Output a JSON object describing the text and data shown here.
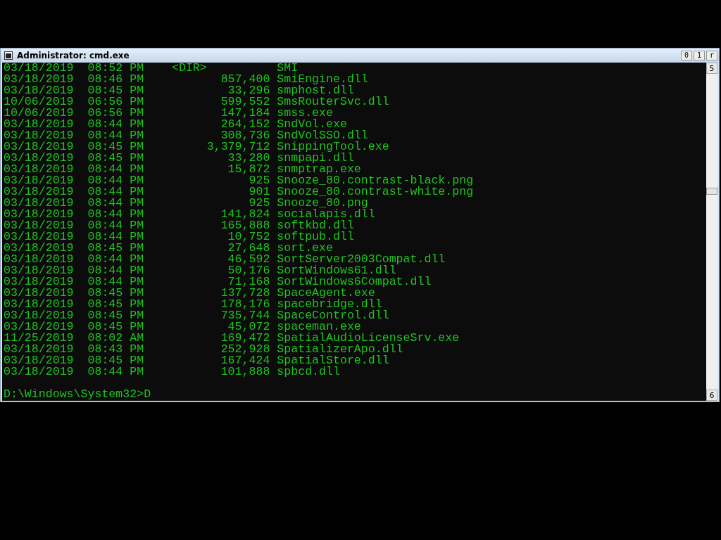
{
  "window": {
    "title": "Administrator: cmd.exe",
    "caption_buttons": [
      "0",
      "1",
      "r"
    ]
  },
  "scrollbar": {
    "up_arrow": "5",
    "down_arrow": "6"
  },
  "listing": [
    {
      "kind": "dir",
      "date": "03/18/2019",
      "time": "08:52",
      "meridiem": "PM",
      "size": "<DIR>",
      "name": "SMI"
    },
    {
      "kind": "file",
      "date": "03/18/2019",
      "time": "08:46",
      "meridiem": "PM",
      "size": "857,400",
      "name": "SmiEngine.dll"
    },
    {
      "kind": "file",
      "date": "03/18/2019",
      "time": "08:45",
      "meridiem": "PM",
      "size": "33,296",
      "name": "smphost.dll"
    },
    {
      "kind": "file",
      "date": "10/06/2019",
      "time": "06:56",
      "meridiem": "PM",
      "size": "599,552",
      "name": "SmsRouterSvc.dll"
    },
    {
      "kind": "file",
      "date": "10/06/2019",
      "time": "06:56",
      "meridiem": "PM",
      "size": "147,184",
      "name": "smss.exe"
    },
    {
      "kind": "file",
      "date": "03/18/2019",
      "time": "08:44",
      "meridiem": "PM",
      "size": "264,152",
      "name": "SndVol.exe"
    },
    {
      "kind": "file",
      "date": "03/18/2019",
      "time": "08:44",
      "meridiem": "PM",
      "size": "308,736",
      "name": "SndVolSSO.dll"
    },
    {
      "kind": "file",
      "date": "03/18/2019",
      "time": "08:45",
      "meridiem": "PM",
      "size": "3,379,712",
      "name": "SnippingTool.exe"
    },
    {
      "kind": "file",
      "date": "03/18/2019",
      "time": "08:45",
      "meridiem": "PM",
      "size": "33,280",
      "name": "snmpapi.dll"
    },
    {
      "kind": "file",
      "date": "03/18/2019",
      "time": "08:44",
      "meridiem": "PM",
      "size": "15,872",
      "name": "snmptrap.exe"
    },
    {
      "kind": "file",
      "date": "03/18/2019",
      "time": "08:44",
      "meridiem": "PM",
      "size": "925",
      "name": "Snooze_80.contrast-black.png"
    },
    {
      "kind": "file",
      "date": "03/18/2019",
      "time": "08:44",
      "meridiem": "PM",
      "size": "901",
      "name": "Snooze_80.contrast-white.png"
    },
    {
      "kind": "file",
      "date": "03/18/2019",
      "time": "08:44",
      "meridiem": "PM",
      "size": "925",
      "name": "Snooze_80.png"
    },
    {
      "kind": "file",
      "date": "03/18/2019",
      "time": "08:44",
      "meridiem": "PM",
      "size": "141,824",
      "name": "socialapis.dll"
    },
    {
      "kind": "file",
      "date": "03/18/2019",
      "time": "08:44",
      "meridiem": "PM",
      "size": "165,888",
      "name": "softkbd.dll"
    },
    {
      "kind": "file",
      "date": "03/18/2019",
      "time": "08:44",
      "meridiem": "PM",
      "size": "10,752",
      "name": "softpub.dll"
    },
    {
      "kind": "file",
      "date": "03/18/2019",
      "time": "08:45",
      "meridiem": "PM",
      "size": "27,648",
      "name": "sort.exe"
    },
    {
      "kind": "file",
      "date": "03/18/2019",
      "time": "08:44",
      "meridiem": "PM",
      "size": "46,592",
      "name": "SortServer2003Compat.dll"
    },
    {
      "kind": "file",
      "date": "03/18/2019",
      "time": "08:44",
      "meridiem": "PM",
      "size": "50,176",
      "name": "SortWindows61.dll"
    },
    {
      "kind": "file",
      "date": "03/18/2019",
      "time": "08:44",
      "meridiem": "PM",
      "size": "71,168",
      "name": "SortWindows6Compat.dll"
    },
    {
      "kind": "file",
      "date": "03/18/2019",
      "time": "08:45",
      "meridiem": "PM",
      "size": "137,728",
      "name": "SpaceAgent.exe"
    },
    {
      "kind": "file",
      "date": "03/18/2019",
      "time": "08:45",
      "meridiem": "PM",
      "size": "178,176",
      "name": "spacebridge.dll"
    },
    {
      "kind": "file",
      "date": "03/18/2019",
      "time": "08:45",
      "meridiem": "PM",
      "size": "735,744",
      "name": "SpaceControl.dll"
    },
    {
      "kind": "file",
      "date": "03/18/2019",
      "time": "08:45",
      "meridiem": "PM",
      "size": "45,072",
      "name": "spaceman.exe"
    },
    {
      "kind": "file",
      "date": "11/25/2019",
      "time": "08:02",
      "meridiem": "AM",
      "size": "169,472",
      "name": "SpatialAudioLicenseSrv.exe"
    },
    {
      "kind": "file",
      "date": "03/18/2019",
      "time": "08:43",
      "meridiem": "PM",
      "size": "252,928",
      "name": "SpatializerApo.dll"
    },
    {
      "kind": "file",
      "date": "03/18/2019",
      "time": "08:45",
      "meridiem": "PM",
      "size": "167,424",
      "name": "SpatialStore.dll"
    },
    {
      "kind": "file",
      "date": "03/18/2019",
      "time": "08:44",
      "meridiem": "PM",
      "size": "101,888",
      "name": "spbcd.dll"
    }
  ],
  "prompt": "D:\\Windows\\System32>D"
}
